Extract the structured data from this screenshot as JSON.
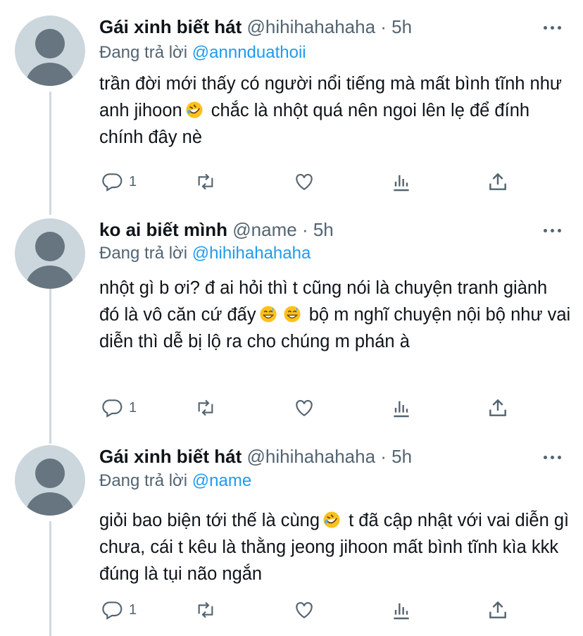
{
  "colors": {
    "link": "#1d9bf0",
    "muted": "#536471",
    "text": "#0f1419",
    "thread_line": "#cfd9de",
    "avatar_bg": "#ccd6dd"
  },
  "replying_prefix": "Đang trả lời",
  "tweets": [
    {
      "name": "Gái xinh biết hát",
      "handle": "@hihihahahaha",
      "dot": "·",
      "time": "5h",
      "replying_to": "@annnduathoii",
      "text_parts": [
        "trần đời mới thấy có người nổi tiếng mà mất bình tĩnh như anh jihoon",
        " chắc là nhột quá nên ngoi lên lẹ để đính chính đây nè"
      ],
      "emojis": [
        "rofl-emoji"
      ],
      "reply_count": "1"
    },
    {
      "name": "ko ai biết mình",
      "handle": "@name",
      "dot": "·",
      "time": "5h",
      "replying_to": "@hihihahahaha",
      "text_parts": [
        "nhột gì b ơi? đ ai hỏi thì t cũng nói là chuyện tranh giành đó là vô căn cứ đấy",
        " bộ m nghĩ chuyện nội bộ như vai diễn thì dễ bị lộ ra cho chúng m phán à"
      ],
      "emojis": [
        "grinning-sweat-emoji",
        "grinning-sweat-emoji"
      ],
      "reply_count": "1"
    },
    {
      "name": "Gái xinh biết hát",
      "handle": "@hihihahahaha",
      "dot": "·",
      "time": "5h",
      "replying_to": "@name",
      "text_parts": [
        "giỏi bao biện tới thế là cùng",
        " t đã cập nhật với vai diễn gì chưa, cái t kêu là thằng jeong jihoon mất bình tĩnh kìa kkk đúng là tụi não ngắn"
      ],
      "emojis": [
        "rofl-emoji"
      ],
      "reply_count": "1"
    }
  ]
}
